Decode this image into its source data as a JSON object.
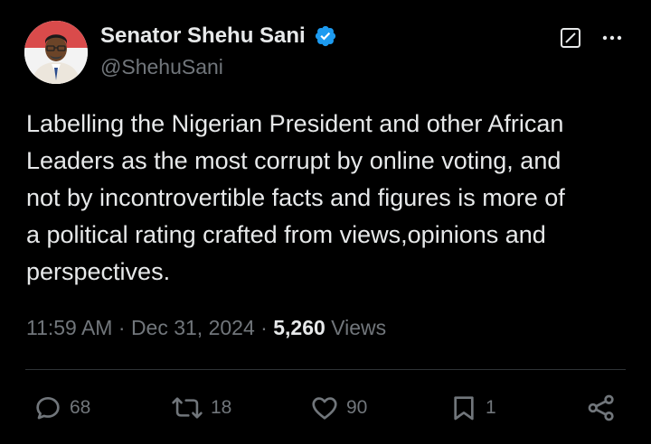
{
  "author": {
    "display_name": "Senator Shehu Sani",
    "handle": "@ShehuSani",
    "verified": true,
    "avatar_icon": "profile-photo"
  },
  "tweet": {
    "text": "Labelling the Nigerian President and other African\nLeaders as the most corrupt by online voting, and\nnot by incontrovertible facts and figures is more of\na political rating crafted from views,opinions and\nperspectives.",
    "time": "11:59 AM",
    "date": "Dec 31, 2024",
    "separator": "·",
    "views_count": "5,260",
    "views_label": "Views"
  },
  "actions": {
    "replies": "68",
    "reposts": "18",
    "likes": "90",
    "bookmarks": "1"
  },
  "icons": {
    "verified": "verified-badge-icon",
    "grok": "grok-icon",
    "more": "more-icon",
    "reply": "reply-icon",
    "repost": "repost-icon",
    "like": "heart-icon",
    "bookmark": "bookmark-icon",
    "share": "share-icon"
  },
  "colors": {
    "background": "#000000",
    "text_primary": "#e7e9ea",
    "text_secondary": "#71767b",
    "verified_blue": "#1d9bf0",
    "divider": "#2f3336"
  }
}
